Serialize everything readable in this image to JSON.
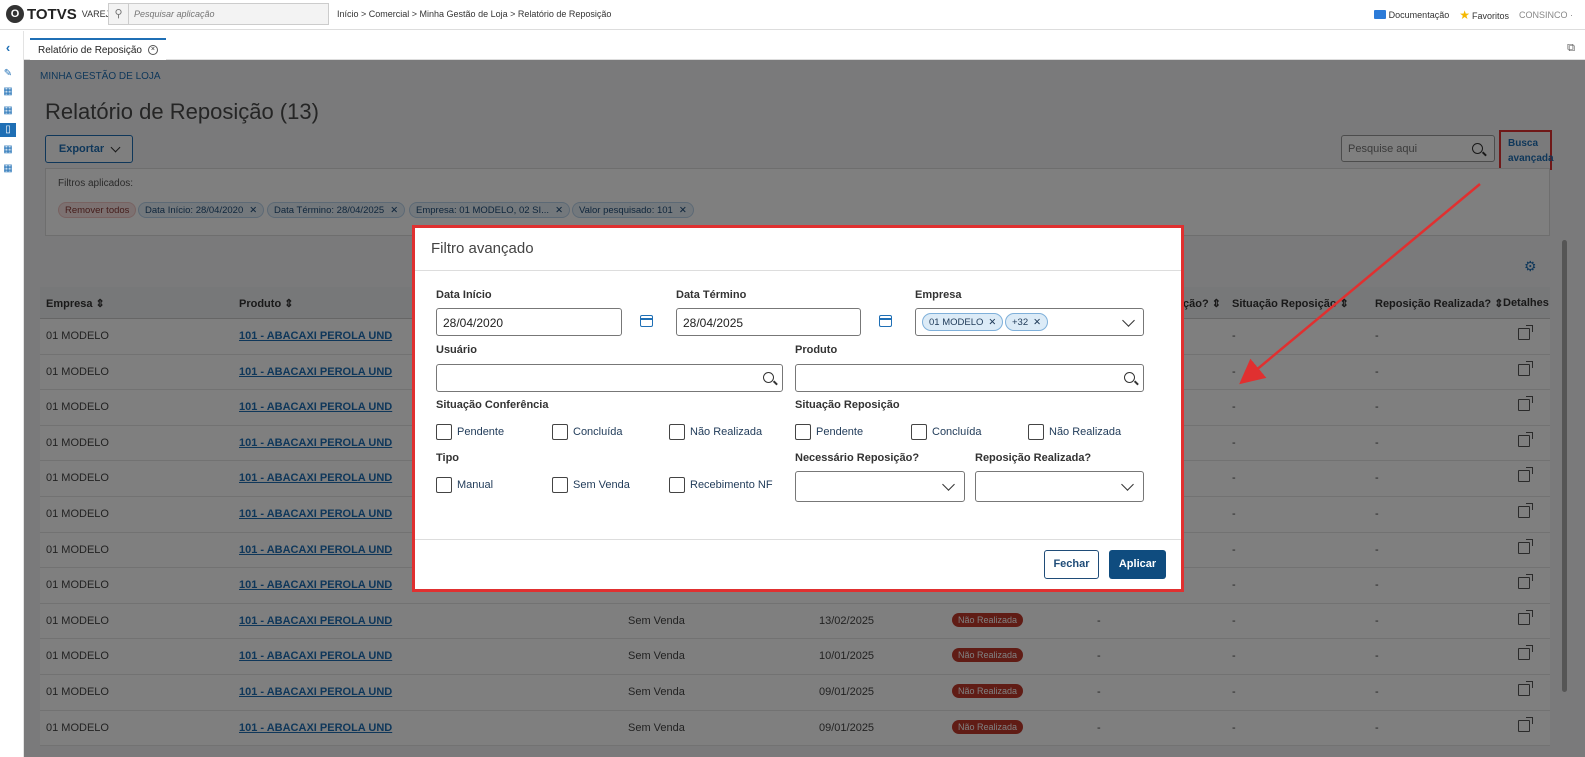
{
  "topbar": {
    "logo_mark": "O",
    "brand": "TOTVS",
    "brand_sub": "VAREJO",
    "search_placeholder": "Pesquisar aplicação",
    "breadcrumb": "Início > Comercial > Minha Gestão de Loja > Relatório de Reposição",
    "doc_label": "Documentação",
    "fav_label": "Favoritos",
    "user_label": "CONSINCO ·"
  },
  "tab": {
    "label": "Relatório de Reposição",
    "close": "×"
  },
  "page": {
    "crumb": "MINHA GESTÃO DE LOJA",
    "title": "Relatório de Reposição (13)",
    "export_label": "Exportar",
    "search_placeholder": "Pesquise aqui",
    "busca_line1": "Busca",
    "busca_line2": "avançada",
    "filters_label": "Filtros aplicados:",
    "chips": [
      "Remover todos",
      "Data Início: 28/04/2020",
      "Data Término: 28/04/2025",
      "Empresa: 01 MODELO, 02 SI...",
      "Valor pesquisado: 101"
    ]
  },
  "table": {
    "headers": [
      "Empresa",
      "Produto",
      "ição?",
      "Situação Reposição",
      "Reposição Realizada?",
      "Detalhes"
    ],
    "rows": [
      {
        "empresa": "01 MODELO",
        "produto": "101 - ABACAXI PEROLA UND",
        "tipo": "",
        "data": "",
        "status": "",
        "nec": "",
        "sit": "-",
        "real": "-"
      },
      {
        "empresa": "01 MODELO",
        "produto": "101 - ABACAXI PEROLA UND",
        "tipo": "",
        "data": "",
        "status": "",
        "nec": "",
        "sit": "-",
        "real": "-"
      },
      {
        "empresa": "01 MODELO",
        "produto": "101 - ABACAXI PEROLA UND",
        "tipo": "",
        "data": "",
        "status": "",
        "nec": "",
        "sit": "-",
        "real": "-"
      },
      {
        "empresa": "01 MODELO",
        "produto": "101 - ABACAXI PEROLA UND",
        "tipo": "",
        "data": "",
        "status": "",
        "nec": "",
        "sit": "-",
        "real": "-"
      },
      {
        "empresa": "01 MODELO",
        "produto": "101 - ABACAXI PEROLA UND",
        "tipo": "",
        "data": "",
        "status": "",
        "nec": "",
        "sit": "-",
        "real": "-"
      },
      {
        "empresa": "01 MODELO",
        "produto": "101 - ABACAXI PEROLA UND",
        "tipo": "",
        "data": "",
        "status": "",
        "nec": "",
        "sit": "-",
        "real": "-"
      },
      {
        "empresa": "01 MODELO",
        "produto": "101 - ABACAXI PEROLA UND",
        "tipo": "",
        "data": "",
        "status": "",
        "nec": "",
        "sit": "-",
        "real": "-"
      },
      {
        "empresa": "01 MODELO",
        "produto": "101 - ABACAXI PEROLA UND",
        "tipo": "",
        "data": "",
        "status": "",
        "nec": "",
        "sit": "-",
        "real": "-"
      },
      {
        "empresa": "01 MODELO",
        "produto": "101 - ABACAXI PEROLA UND",
        "tipo": "Sem Venda",
        "data": "13/02/2025",
        "status": "Não Realizada",
        "nec": "-",
        "sit": "-",
        "real": "-"
      },
      {
        "empresa": "01 MODELO",
        "produto": "101 - ABACAXI PEROLA UND",
        "tipo": "Sem Venda",
        "data": "10/01/2025",
        "status": "Não Realizada",
        "nec": "-",
        "sit": "-",
        "real": "-"
      },
      {
        "empresa": "01 MODELO",
        "produto": "101 - ABACAXI PEROLA UND",
        "tipo": "Sem Venda",
        "data": "09/01/2025",
        "status": "Não Realizada",
        "nec": "-",
        "sit": "-",
        "real": "-"
      },
      {
        "empresa": "01 MODELO",
        "produto": "101 - ABACAXI PEROLA UND",
        "tipo": "Sem Venda",
        "data": "09/01/2025",
        "status": "Não Realizada",
        "nec": "-",
        "sit": "-",
        "real": "-"
      }
    ]
  },
  "modal": {
    "title": "Filtro avançado",
    "data_inicio_label": "Data Início",
    "data_inicio_value": "28/04/2020",
    "data_termino_label": "Data Término",
    "data_termino_value": "28/04/2025",
    "empresa_label": "Empresa",
    "empresa_tags": [
      "01 MODELO",
      "+32"
    ],
    "usuario_label": "Usuário",
    "produto_label": "Produto",
    "sit_conf_label": "Situação Conferência",
    "sit_conf_options": [
      "Pendente",
      "Concluída",
      "Não Realizada"
    ],
    "sit_rep_label": "Situação Reposição",
    "sit_rep_options": [
      "Pendente",
      "Concluída",
      "Não Realizada"
    ],
    "tipo_label": "Tipo",
    "tipo_options": [
      "Manual",
      "Sem Venda",
      "Recebimento NF"
    ],
    "nec_label": "Necessário Reposição?",
    "realizada_label": "Reposição Realizada?",
    "fechar_label": "Fechar",
    "aplicar_label": "Aplicar"
  },
  "colors": {
    "accent": "#1f6fb5",
    "highlight": "#e03030",
    "primary_button": "#0f4c7f",
    "badge": "#c0392b"
  }
}
